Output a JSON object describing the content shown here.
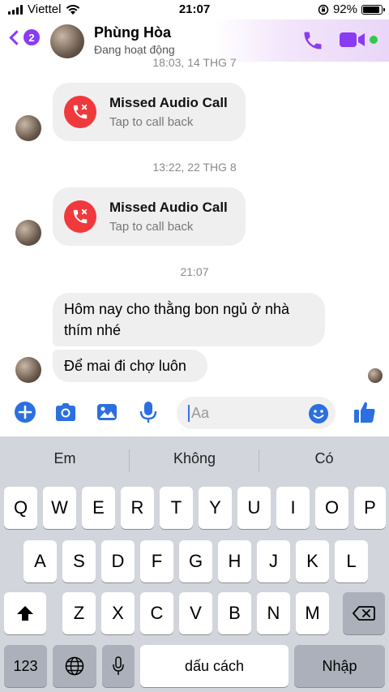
{
  "status_bar": {
    "carrier": "Viettel",
    "time": "21:07",
    "battery": "92%",
    "battery_level": 0.92
  },
  "header": {
    "back_count": "2",
    "name": "Phùng Hòa",
    "status": "Đang hoạt động"
  },
  "chat": {
    "timestamps": [
      "18:03, 14 THG 7",
      "13:22, 22 THG 8",
      "21:07"
    ],
    "calls": [
      {
        "title": "Missed Audio Call",
        "subtitle": "Tap to call back"
      },
      {
        "title": "Missed Audio Call",
        "subtitle": "Tap to call back"
      }
    ],
    "messages": [
      "Hôm nay cho thằng bon ngủ ở nhà thím nhé",
      "Để mai đi chợ luôn"
    ]
  },
  "composer": {
    "placeholder": "Aa"
  },
  "keyboard": {
    "suggestions": [
      "Em",
      "Không",
      "Có"
    ],
    "row1": [
      "Q",
      "W",
      "E",
      "R",
      "T",
      "Y",
      "U",
      "I",
      "O",
      "P"
    ],
    "row2": [
      "A",
      "S",
      "D",
      "F",
      "G",
      "H",
      "J",
      "K",
      "L"
    ],
    "row3": [
      "Z",
      "X",
      "C",
      "V",
      "B",
      "N",
      "M"
    ],
    "numbers_key": "123",
    "space_key": "dấu cách",
    "return_key": "Nhập"
  },
  "colors": {
    "accent": "#8a3cf0",
    "composer_icon": "#2c6fe0",
    "missed_call": "#f0393c",
    "online": "#31c94c"
  }
}
